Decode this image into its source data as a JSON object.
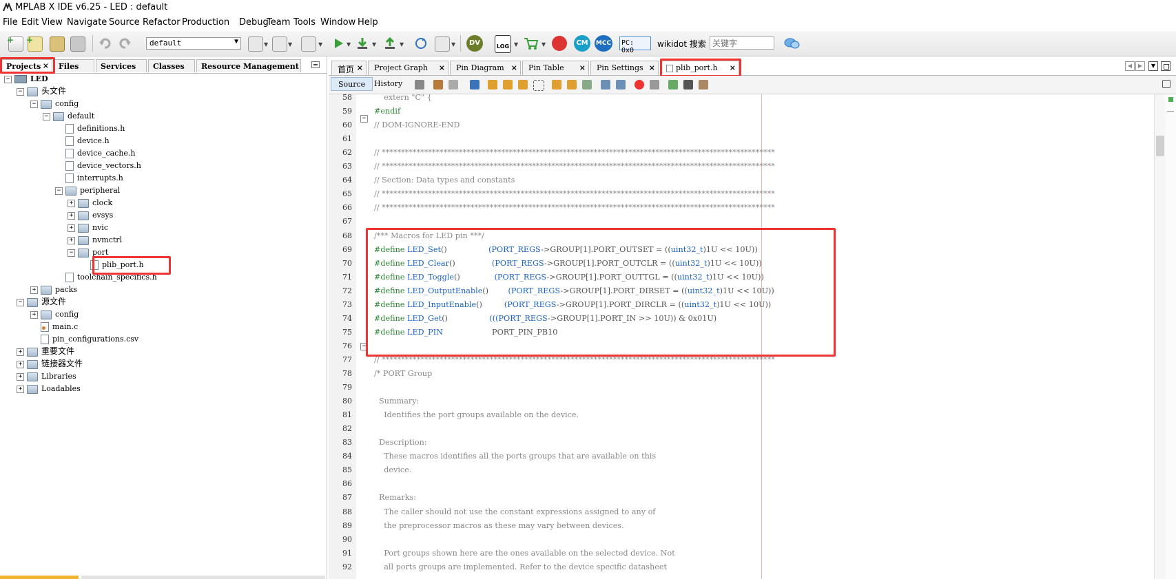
{
  "window": {
    "title": "MPLAB X IDE v6.25 - LED : default"
  },
  "menu": [
    "File",
    "Edit",
    "View",
    "Navigate",
    "Source",
    "Refactor",
    "Production",
    "Debug",
    "Team",
    "Tools",
    "Window",
    "Help"
  ],
  "toolbar": {
    "config_value": "default",
    "pc_label": "PC: 0x0",
    "wikidot_label": "wikidot 搜索",
    "search_placeholder": "关键字"
  },
  "left_panel": {
    "tabs": [
      {
        "label": "Projects",
        "close": "×"
      },
      {
        "label": "Files"
      },
      {
        "label": "Services"
      },
      {
        "label": "Classes"
      },
      {
        "label": "Resource Management [..."
      }
    ],
    "tree": [
      {
        "label": "LED",
        "level": 0,
        "icon": "project",
        "toggle": "−"
      },
      {
        "label": "头文件",
        "level": 1,
        "icon": "folder",
        "toggle": "−"
      },
      {
        "label": "config",
        "level": 2,
        "icon": "folder",
        "toggle": "−"
      },
      {
        "label": "default",
        "level": 3,
        "icon": "folder",
        "toggle": "−"
      },
      {
        "label": "definitions.h",
        "level": 4,
        "icon": "file"
      },
      {
        "label": "device.h",
        "level": 4,
        "icon": "file"
      },
      {
        "label": "device_cache.h",
        "level": 4,
        "icon": "file"
      },
      {
        "label": "device_vectors.h",
        "level": 4,
        "icon": "file"
      },
      {
        "label": "interrupts.h",
        "level": 4,
        "icon": "file"
      },
      {
        "label": "peripheral",
        "level": 4,
        "icon": "folder",
        "toggle": "−"
      },
      {
        "label": "clock",
        "level": 5,
        "icon": "folder",
        "toggle": "+"
      },
      {
        "label": "evsys",
        "level": 5,
        "icon": "folder",
        "toggle": "+"
      },
      {
        "label": "nvic",
        "level": 5,
        "icon": "folder",
        "toggle": "+"
      },
      {
        "label": "nvmctrl",
        "level": 5,
        "icon": "folder",
        "toggle": "+"
      },
      {
        "label": "port",
        "level": 5,
        "icon": "folder",
        "toggle": "−"
      },
      {
        "label": "plib_port.h",
        "level": 6,
        "icon": "file"
      },
      {
        "label": "toolchain_specifics.h",
        "level": 4,
        "icon": "file"
      },
      {
        "label": "packs",
        "level": 2,
        "icon": "folder",
        "toggle": "+"
      },
      {
        "label": "源文件",
        "level": 1,
        "icon": "folder",
        "toggle": "−"
      },
      {
        "label": "config",
        "level": 2,
        "icon": "folder",
        "toggle": "+"
      },
      {
        "label": "main.c",
        "level": 2,
        "icon": "cfile"
      },
      {
        "label": "pin_configurations.csv",
        "level": 2,
        "icon": "file"
      },
      {
        "label": "重要文件",
        "level": 1,
        "icon": "folder",
        "toggle": "+"
      },
      {
        "label": "链接器文件",
        "level": 1,
        "icon": "folder",
        "toggle": "+"
      },
      {
        "label": "Libraries",
        "level": 1,
        "icon": "folder",
        "toggle": "+"
      },
      {
        "label": "Loadables",
        "level": 1,
        "icon": "folder",
        "toggle": "+"
      }
    ]
  },
  "editor": {
    "tabs": [
      {
        "label": "首页"
      },
      {
        "label": "Project Graph"
      },
      {
        "label": "Pin Diagram"
      },
      {
        "label": "Pin Table"
      },
      {
        "label": "Pin Settings"
      },
      {
        "label": "plib_port.h",
        "active": true
      }
    ],
    "close_glyph": "×",
    "source_tab": "Source",
    "history_tab": "History",
    "line_numbers": [
      58,
      59,
      60,
      61,
      62,
      63,
      64,
      65,
      66,
      67,
      68,
      69,
      70,
      71,
      72,
      73,
      74,
      75,
      76,
      77,
      78,
      79,
      80,
      81,
      82,
      83,
      84,
      85,
      86,
      87,
      88,
      89,
      90,
      91,
      92
    ],
    "lines": [
      [
        {
          "t": "    extern \"C\" {",
          "c": "cm"
        }
      ],
      [
        {
          "t": "#endif",
          "c": "kw-pre"
        }
      ],
      [
        {
          "t": "// DOM-IGNORE-END",
          "c": "cm"
        }
      ],
      [
        {
          "t": "",
          "c": "cm"
        }
      ],
      [
        {
          "t": "// ******************************************************************************************************",
          "c": "cm"
        }
      ],
      [
        {
          "t": "// ******************************************************************************************************",
          "c": "cm"
        }
      ],
      [
        {
          "t": "// Section: Data types and constants",
          "c": "cm"
        }
      ],
      [
        {
          "t": "// ******************************************************************************************************",
          "c": "cm"
        }
      ],
      [
        {
          "t": "// ******************************************************************************************************",
          "c": "cm"
        }
      ],
      [
        {
          "t": "",
          "c": "cm"
        }
      ],
      [
        {
          "t": "/*** Macros for LED pin ***/",
          "c": "cm"
        }
      ],
      [
        {
          "t": "#define",
          "c": "kw-pre"
        },
        {
          "t": " ",
          "c": ""
        },
        {
          "t": "LED_Set",
          "c": "kw-blue"
        },
        {
          "t": "()                 ",
          "c": ""
        },
        {
          "t": "(PORT_REGS",
          "c": "kw-blue"
        },
        {
          "t": "->GROUP[1].PORT_OUTSET = ((",
          "c": ""
        },
        {
          "t": "uint32_t",
          "c": "kw-blue"
        },
        {
          "t": ")1U << 10U))",
          "c": ""
        }
      ],
      [
        {
          "t": "#define",
          "c": "kw-pre"
        },
        {
          "t": " ",
          "c": ""
        },
        {
          "t": "LED_Clear",
          "c": "kw-blue"
        },
        {
          "t": "()               ",
          "c": ""
        },
        {
          "t": "(PORT_REGS",
          "c": "kw-blue"
        },
        {
          "t": "->GROUP[1].PORT_OUTCLR = ((",
          "c": ""
        },
        {
          "t": "uint32_t",
          "c": "kw-blue"
        },
        {
          "t": ")1U << 10U))",
          "c": ""
        }
      ],
      [
        {
          "t": "#define",
          "c": "kw-pre"
        },
        {
          "t": " ",
          "c": ""
        },
        {
          "t": "LED_Toggle",
          "c": "kw-blue"
        },
        {
          "t": "()              ",
          "c": ""
        },
        {
          "t": "(PORT_REGS",
          "c": "kw-blue"
        },
        {
          "t": "->GROUP[1].PORT_OUTTGL = ((",
          "c": ""
        },
        {
          "t": "uint32_t",
          "c": "kw-blue"
        },
        {
          "t": ")1U << 10U))",
          "c": ""
        }
      ],
      [
        {
          "t": "#define",
          "c": "kw-pre"
        },
        {
          "t": " ",
          "c": ""
        },
        {
          "t": "LED_OutputEnable",
          "c": "kw-blue"
        },
        {
          "t": "()        ",
          "c": ""
        },
        {
          "t": "(PORT_REGS",
          "c": "kw-blue"
        },
        {
          "t": "->GROUP[1].PORT_DIRSET = ((",
          "c": ""
        },
        {
          "t": "uint32_t",
          "c": "kw-blue"
        },
        {
          "t": ")1U << 10U))",
          "c": ""
        }
      ],
      [
        {
          "t": "#define",
          "c": "kw-pre"
        },
        {
          "t": " ",
          "c": ""
        },
        {
          "t": "LED_InputEnable",
          "c": "kw-blue"
        },
        {
          "t": "()         ",
          "c": ""
        },
        {
          "t": "(PORT_REGS",
          "c": "kw-blue"
        },
        {
          "t": "->GROUP[1].PORT_DIRCLR = ((",
          "c": ""
        },
        {
          "t": "uint32_t",
          "c": "kw-blue"
        },
        {
          "t": ")1U << 10U))",
          "c": ""
        }
      ],
      [
        {
          "t": "#define",
          "c": "kw-pre"
        },
        {
          "t": " ",
          "c": ""
        },
        {
          "t": "LED_Get",
          "c": "kw-blue"
        },
        {
          "t": "()                 ",
          "c": ""
        },
        {
          "t": "(((PORT_REGS",
          "c": "kw-blue"
        },
        {
          "t": "->GROUP[1].PORT_IN >> 10U)) & 0x01U)",
          "c": ""
        }
      ],
      [
        {
          "t": "#define",
          "c": "kw-pre"
        },
        {
          "t": " ",
          "c": ""
        },
        {
          "t": "LED_PIN",
          "c": "kw-blue"
        },
        {
          "t": "                    PORT_PIN_PB10",
          "c": ""
        }
      ],
      [
        {
          "t": "",
          "c": "cm"
        }
      ],
      [
        {
          "t": "// ******************************************************************************************************",
          "c": "cm"
        }
      ],
      [
        {
          "t": "/* PORT Group",
          "c": "cm"
        }
      ],
      [
        {
          "t": "",
          "c": "cm"
        }
      ],
      [
        {
          "t": "  Summary:",
          "c": "cm"
        }
      ],
      [
        {
          "t": "    Identifies the port groups available on the device.",
          "c": "cm"
        }
      ],
      [
        {
          "t": "",
          "c": "cm"
        }
      ],
      [
        {
          "t": "  Description:",
          "c": "cm"
        }
      ],
      [
        {
          "t": "    These macros identifies all the ports groups that are available on this",
          "c": "cm"
        }
      ],
      [
        {
          "t": "    device.",
          "c": "cm"
        }
      ],
      [
        {
          "t": "",
          "c": "cm"
        }
      ],
      [
        {
          "t": "  Remarks:",
          "c": "cm"
        }
      ],
      [
        {
          "t": "    The caller should not use the constant expressions assigned to any of",
          "c": "cm"
        }
      ],
      [
        {
          "t": "    the preprocessor macros as these may vary between devices.",
          "c": "cm"
        }
      ],
      [
        {
          "t": "",
          "c": "cm"
        }
      ],
      [
        {
          "t": "    Port groups shown here are the ones available on the selected device. Not",
          "c": "cm"
        }
      ],
      [
        {
          "t": "    all ports groups are implemented. Refer to the device specific datasheet",
          "c": "cm"
        }
      ]
    ]
  },
  "colors": {
    "highlight": "#e33333",
    "keyword_pre": "#2f8a36",
    "keyword_blue": "#1b63c6"
  }
}
